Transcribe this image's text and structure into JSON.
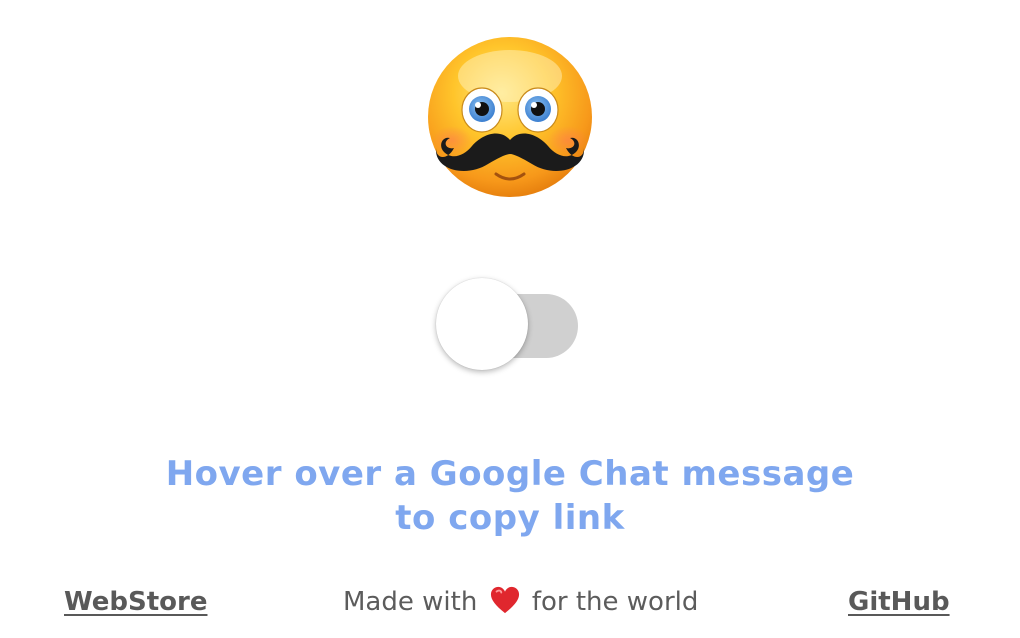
{
  "logo": {
    "icon": "mustache-emoji-icon"
  },
  "toggle": {
    "state": "off",
    "track_color": "#d0d0d0",
    "knob_color": "#ffffff"
  },
  "instruction": {
    "line1": "Hover over a Google Chat message",
    "line2": "to copy link",
    "color": "#7fa7ef"
  },
  "footer": {
    "webstore_label": "WebStore",
    "made_with_prefix": "Made with",
    "heart_icon": "heart-icon",
    "made_with_suffix": "for the world",
    "github_label": "GitHub",
    "heart_color": "#e0272e"
  }
}
